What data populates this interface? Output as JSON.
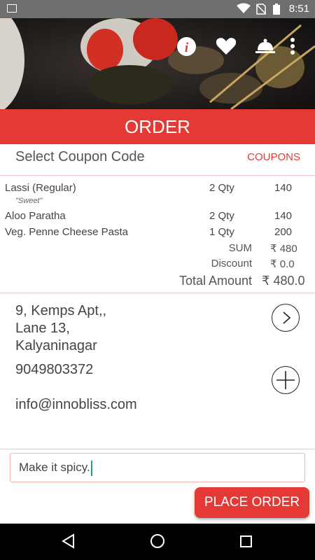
{
  "status_bar": {
    "time": "8:51",
    "icons": [
      "image-icon",
      "wifi-icon",
      "no-sim-icon",
      "battery-icon"
    ]
  },
  "hero": {
    "actions": [
      "info-icon",
      "heart-icon",
      "cloche-icon",
      "more-vert-icon"
    ]
  },
  "header": {
    "title": "ORDER"
  },
  "coupon": {
    "label": "Select Coupon Code",
    "link": "COUPONS"
  },
  "items": [
    {
      "name": "Lassi (Regular)",
      "note": "\"Sweet\"",
      "qty": "2 Qty",
      "price": "140"
    },
    {
      "name": "Aloo Paratha",
      "qty": "2 Qty",
      "price": "140"
    },
    {
      "name": "Veg. Penne Cheese Pasta",
      "qty": "1 Qty",
      "price": "200"
    }
  ],
  "summary": {
    "sum_label": "SUM",
    "sum_value": "₹ 480",
    "discount_label": "Discount",
    "discount_value": "₹ 0.0",
    "total_label": "Total Amount",
    "total_value": "₹ 480.0"
  },
  "delivery": {
    "address_line1": "9, Kemps Apt,,",
    "address_line2": "Lane 13,",
    "address_line3": "Kalyaninagar",
    "phone": "9049803372",
    "email": "info@innobliss.com"
  },
  "notes_input": {
    "value": "Make it spicy."
  },
  "place_order": {
    "label": "PLACE ORDER"
  },
  "colors": {
    "accent": "#e53935",
    "status_bar": "#6e6e6e",
    "nav_bar": "#000000",
    "divider": "#f0c7c7"
  }
}
